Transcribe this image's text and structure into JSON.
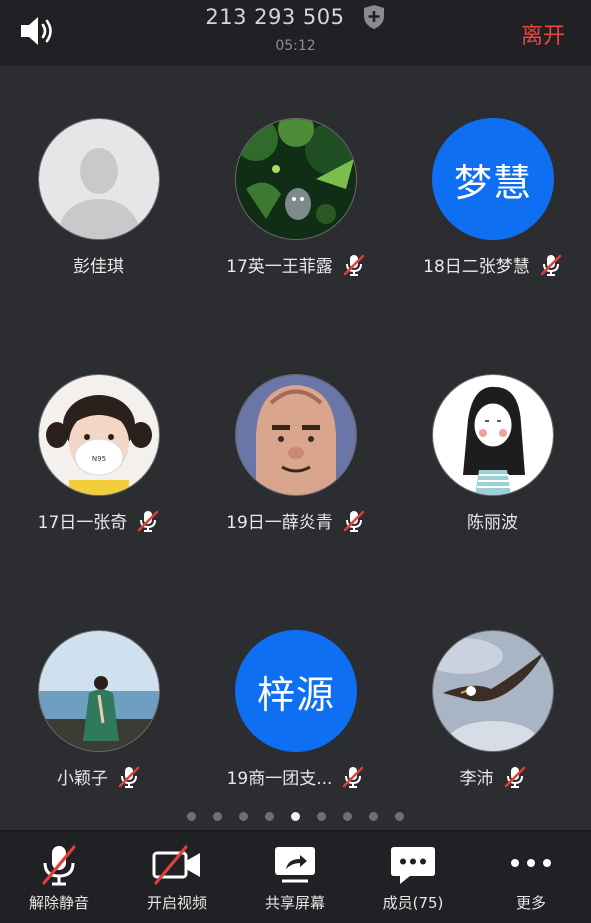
{
  "header": {
    "meeting_id": "213 293 505",
    "timer": "05:12",
    "leave_label": "离开"
  },
  "participants": [
    {
      "name": "彭佳琪",
      "avatar": "default-person",
      "muted": false
    },
    {
      "name": "17英一王菲露",
      "avatar": "forest-photo",
      "muted": true
    },
    {
      "name": "18日二张梦慧",
      "avatar_text": "梦慧",
      "muted": true
    },
    {
      "name": "17日一张奇",
      "avatar": "child-with-mask-photo",
      "muted": true
    },
    {
      "name": "19日一薛炎青",
      "avatar": "cartoon-face-photo",
      "muted": true
    },
    {
      "name": "陈丽波",
      "avatar": "girl-drawing",
      "muted": false
    },
    {
      "name": "小颖子",
      "avatar": "beach-photo",
      "muted": true
    },
    {
      "name": "19商一团支...",
      "avatar_text": "梓源",
      "muted": true
    },
    {
      "name": "李沛",
      "avatar": "eagle-photo",
      "muted": true
    }
  ],
  "pager": {
    "pages": 9,
    "current": 5
  },
  "toolbar": {
    "unmute": "解除静音",
    "video": "开启视频",
    "share": "共享屏幕",
    "members": "成员(75)",
    "more": "更多"
  },
  "colors": {
    "background": "#2c2d31",
    "bar": "#202124",
    "accent_blue": "#0f6ff2",
    "leave_red": "#e8473f",
    "mute_slash": "#e0403a"
  }
}
